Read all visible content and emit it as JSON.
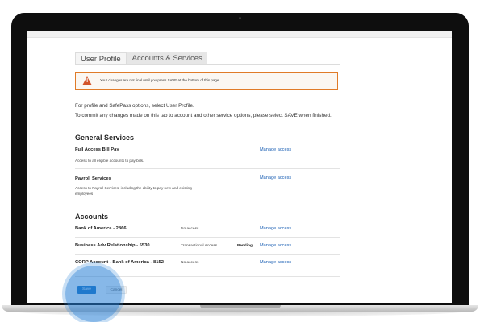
{
  "tabs": [
    {
      "label": "User Profile",
      "active": true
    },
    {
      "label": "Accounts & Services",
      "active": false
    }
  ],
  "warning": {
    "icon": "warning-icon",
    "icon_glyph": "!",
    "color": "#e07b28",
    "text": "Your changes are not final until you press SAVE at the bottom of this page."
  },
  "intro": {
    "line1": "For profile and SafePass options, select User Profile.",
    "line2": "To commit any changes made on this tab to account and other service options, please select SAVE when finished."
  },
  "general_services": {
    "heading": "General Services",
    "items": [
      {
        "name": "Full Access Bill Pay",
        "description": "Access to all eligible accounts to pay bills.",
        "link": "Manage access"
      },
      {
        "name": "Payroll Services",
        "description": "Access to Payroll Services, including the ability to pay new and existing employees",
        "link": "Manage access"
      }
    ]
  },
  "accounts": {
    "heading": "Accounts",
    "items": [
      {
        "name": "Bank of America - 2866",
        "access": "No access",
        "status": "",
        "link": "Manage access"
      },
      {
        "name": "Business Adv Relationship - 5530",
        "access": "Transactional Access",
        "status": "Pending",
        "link": "Manage access"
      },
      {
        "name": "CORP Account - Bank of America - 8152",
        "access": "No access",
        "status": "",
        "link": "Manage access"
      }
    ]
  },
  "actions": {
    "save_label": "Save",
    "cancel_label": "Cancel"
  },
  "colors": {
    "link": "#1a5fb4",
    "save_button": "#1a73c4",
    "click_highlight": "#247ed6",
    "warning_border": "#e07b28",
    "warning_icon": "#d3542a"
  }
}
